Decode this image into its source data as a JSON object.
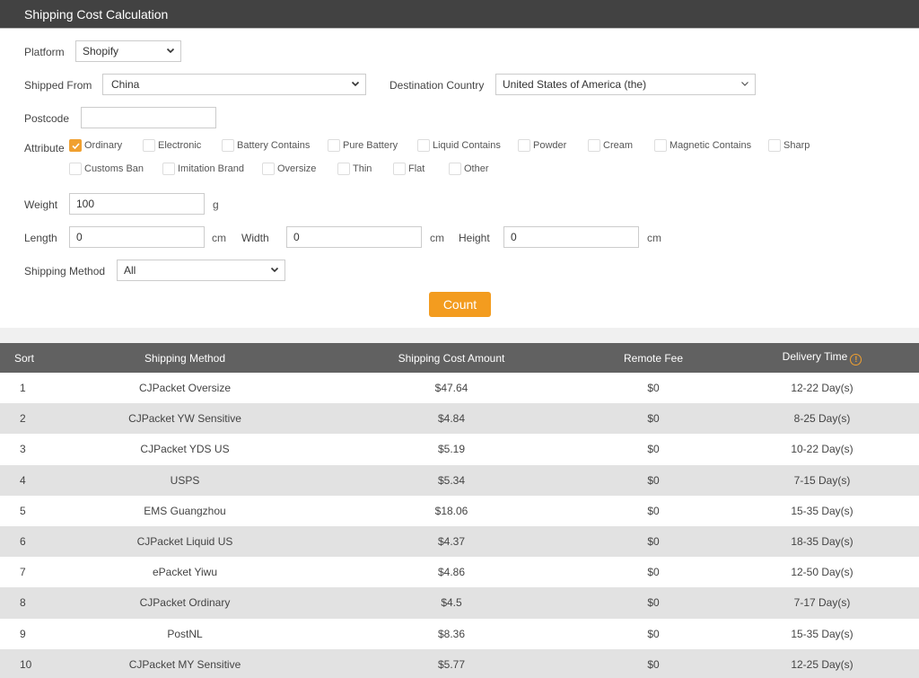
{
  "header": {
    "title": "Shipping Cost Calculation"
  },
  "form": {
    "platform": {
      "label": "Platform",
      "value": "Shopify"
    },
    "shipped_from": {
      "label": "Shipped From",
      "value": "China"
    },
    "destination": {
      "label": "Destination Country",
      "value": "United States of America (the)"
    },
    "postcode": {
      "label": "Postcode",
      "value": ""
    },
    "attribute": {
      "label": "Attribute",
      "options": [
        {
          "label": "Ordinary",
          "checked": true
        },
        {
          "label": "Electronic",
          "checked": false
        },
        {
          "label": "Battery Contains",
          "checked": false
        },
        {
          "label": "Pure Battery",
          "checked": false
        },
        {
          "label": "Liquid Contains",
          "checked": false
        },
        {
          "label": "Powder",
          "checked": false
        },
        {
          "label": "Cream",
          "checked": false
        },
        {
          "label": "Magnetic Contains",
          "checked": false
        },
        {
          "label": "Sharp",
          "checked": false
        },
        {
          "label": "Customs Ban",
          "checked": false
        },
        {
          "label": "Imitation Brand",
          "checked": false
        },
        {
          "label": "Oversize",
          "checked": false
        },
        {
          "label": "Thin",
          "checked": false
        },
        {
          "label": "Flat",
          "checked": false
        },
        {
          "label": "Other",
          "checked": false
        }
      ]
    },
    "weight": {
      "label": "Weight",
      "value": "100",
      "unit": "g"
    },
    "length": {
      "label": "Length",
      "value": "0",
      "unit": "cm"
    },
    "width": {
      "label": "Width",
      "value": "0",
      "unit": "cm"
    },
    "height": {
      "label": "Height",
      "value": "0",
      "unit": "cm"
    },
    "shipping_method": {
      "label": "Shipping Method",
      "value": "All"
    },
    "count_button": "Count"
  },
  "table": {
    "columns": [
      "Sort",
      "Shipping Method",
      "Shipping Cost Amount",
      "Remote Fee",
      "Delivery Time"
    ],
    "rows": [
      {
        "sort": "1",
        "method": "CJPacket Oversize",
        "cost": "$47.64",
        "remote": "$0",
        "time": "12-22 Day(s)"
      },
      {
        "sort": "2",
        "method": "CJPacket YW Sensitive",
        "cost": "$4.84",
        "remote": "$0",
        "time": "8-25 Day(s)"
      },
      {
        "sort": "3",
        "method": "CJPacket YDS US",
        "cost": "$5.19",
        "remote": "$0",
        "time": "10-22 Day(s)"
      },
      {
        "sort": "4",
        "method": "USPS",
        "cost": "$5.34",
        "remote": "$0",
        "time": "7-15 Day(s)"
      },
      {
        "sort": "5",
        "method": "EMS Guangzhou",
        "cost": "$18.06",
        "remote": "$0",
        "time": "15-35 Day(s)"
      },
      {
        "sort": "6",
        "method": "CJPacket Liquid US",
        "cost": "$4.37",
        "remote": "$0",
        "time": "18-35 Day(s)"
      },
      {
        "sort": "7",
        "method": "ePacket Yiwu",
        "cost": "$4.86",
        "remote": "$0",
        "time": "12-50 Day(s)"
      },
      {
        "sort": "8",
        "method": "CJPacket Ordinary",
        "cost": "$4.5",
        "remote": "$0",
        "time": "7-17 Day(s)"
      },
      {
        "sort": "9",
        "method": "PostNL",
        "cost": "$8.36",
        "remote": "$0",
        "time": "15-35 Day(s)"
      },
      {
        "sort": "10",
        "method": "CJPacket MY Sensitive",
        "cost": "$5.77",
        "remote": "$0",
        "time": "12-25 Day(s)"
      }
    ]
  },
  "colors": {
    "accent": "#f39c1f",
    "header_bg": "#424242",
    "table_header_bg": "#616161",
    "row_alt": "#e2e2e2"
  }
}
